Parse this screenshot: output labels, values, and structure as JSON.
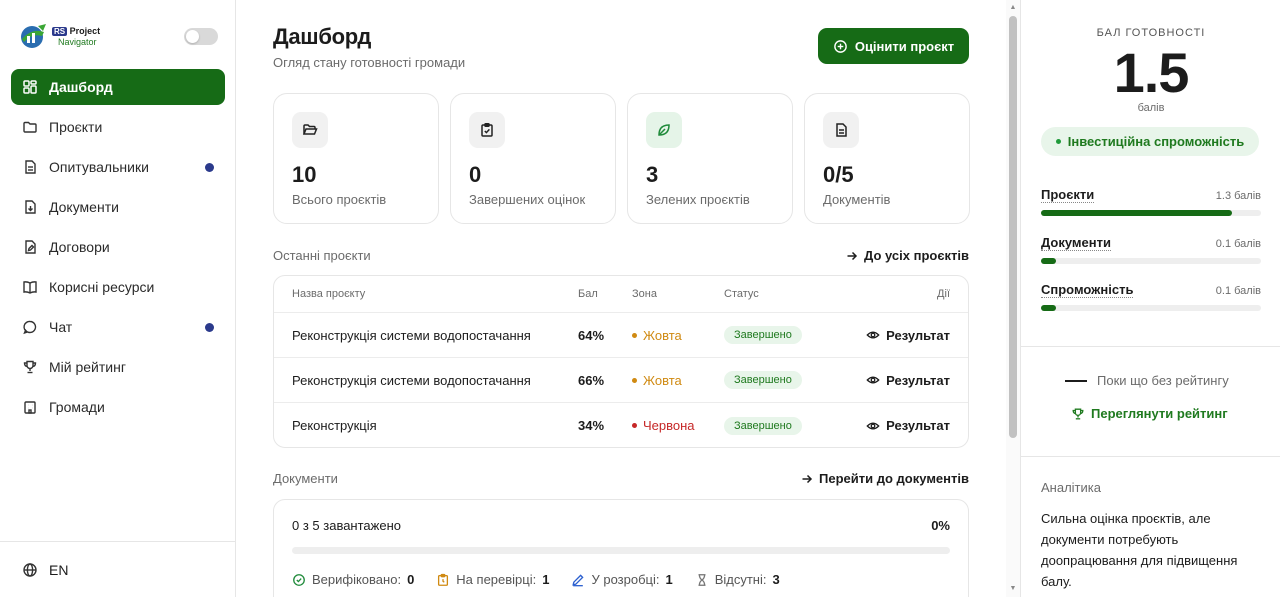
{
  "brand": {
    "rs": "RS",
    "line1": "Project",
    "line2": "Navigator"
  },
  "sidebar": {
    "items": [
      {
        "label": "Дашборд",
        "icon": "dashboard-icon",
        "active": true,
        "dot": false
      },
      {
        "label": "Проєкти",
        "icon": "folder-icon",
        "active": false,
        "dot": false
      },
      {
        "label": "Опитувальники",
        "icon": "document-icon",
        "active": false,
        "dot": true
      },
      {
        "label": "Документи",
        "icon": "file-download-icon",
        "active": false,
        "dot": false
      },
      {
        "label": "Договори",
        "icon": "file-edit-icon",
        "active": false,
        "dot": false
      },
      {
        "label": "Корисні ресурси",
        "icon": "book-icon",
        "active": false,
        "dot": false
      },
      {
        "label": "Чат",
        "icon": "chat-icon",
        "active": false,
        "dot": true
      },
      {
        "label": "Мій рейтинг",
        "icon": "trophy-icon",
        "active": false,
        "dot": false
      },
      {
        "label": "Громади",
        "icon": "building-icon",
        "active": false,
        "dot": false
      }
    ],
    "language": "EN"
  },
  "header": {
    "title": "Дашборд",
    "subtitle": "Огляд стану готовності громади",
    "cta": "Оцінити проєкт"
  },
  "stats": [
    {
      "value": "10",
      "label": "Всього проєктів"
    },
    {
      "value": "0",
      "label": "Завершених оцінок"
    },
    {
      "value": "3",
      "label": "Зелених проєктів"
    },
    {
      "value": "0/5",
      "label": "Документів"
    }
  ],
  "projects": {
    "heading": "Останні проєкти",
    "link": "До усіх проєктів",
    "columns": {
      "name": "Назва проєкту",
      "score": "Бал",
      "zone": "Зона",
      "status": "Статус",
      "actions": "Дії"
    },
    "rows": [
      {
        "name": "Реконструкція системи водопостачання",
        "score": "64%",
        "zone": "Жовта",
        "zone_color": "#d08a12",
        "status": "Завершено",
        "action": "Результат"
      },
      {
        "name": "Реконструкція системи водопостачання",
        "score": "66%",
        "zone": "Жовта",
        "zone_color": "#d08a12",
        "status": "Завершено",
        "action": "Результат"
      },
      {
        "name": "Реконструкція",
        "score": "34%",
        "zone": "Червона",
        "zone_color": "#c62828",
        "status": "Завершено",
        "action": "Результат"
      }
    ]
  },
  "documents": {
    "heading": "Документи",
    "link": "Перейти до документів",
    "uploaded_text": "0 з 5 завантажено",
    "percent": "0%",
    "progress_fraction": 0,
    "legend": [
      {
        "label": "Верифіковано:",
        "value": "0"
      },
      {
        "label": "На перевірці:",
        "value": "1"
      },
      {
        "label": "У розробці:",
        "value": "1"
      },
      {
        "label": "Відсутні:",
        "value": "3"
      }
    ]
  },
  "readiness": {
    "label": "БАЛ ГОТОВНОСТІ",
    "score": "1.5",
    "unit": "балів",
    "category": "Інвестиційна спроможність",
    "metrics": [
      {
        "name": "Проєкти",
        "value": "1.3 балів",
        "fraction": 0.87
      },
      {
        "name": "Документи",
        "value": "0.1 балів",
        "fraction": 0.07
      },
      {
        "name": "Спроможність",
        "value": "0.1 балів",
        "fraction": 0.07
      }
    ]
  },
  "rating": {
    "status": "Поки що без рейтингу",
    "link": "Переглянути рейтинг"
  },
  "analytics": {
    "heading": "Аналітика",
    "text": "Сильна оцінка проєктів, але документи потребують доопрацювання для підвищення балу."
  },
  "colors": {
    "primary": "#166b16",
    "accent_dot": "#2b3a8c",
    "success_bg": "#e8f5ea"
  }
}
